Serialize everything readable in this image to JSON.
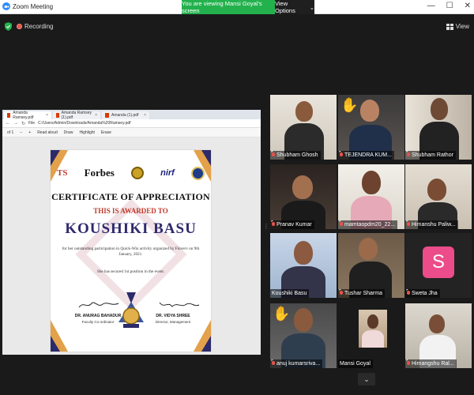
{
  "window": {
    "title": "Zoom Meeting",
    "banner": "You are viewing Mansi Goyal's screen",
    "view_options": "View Options",
    "view_options_chevron": "⌄",
    "controls": {
      "minimize": "—",
      "maximize": "☐",
      "close": "✕"
    }
  },
  "meeting": {
    "recording_label": "Recording",
    "view_label": "View"
  },
  "browser": {
    "tabs": [
      {
        "label": "Amanda Ramsey.pdf",
        "close": "×"
      },
      {
        "label": "Amanda Ramsey (1).pdf",
        "close": "×"
      },
      {
        "label": "Amanda (1).pdf",
        "close": "×"
      }
    ],
    "nav": {
      "back": "←",
      "forward": "→",
      "refresh": "↻"
    },
    "file_label": "File",
    "url": "C:/Users/Admin/Downloads/Amanda%20Ramsey.pdf",
    "toolbar": {
      "page": "of 1",
      "zoom_out": "−",
      "zoom_in": "+",
      "read_aloud": "Read aloud",
      "draw": "Draw",
      "highlight": "Highlight",
      "erase": "Erase"
    }
  },
  "certificate": {
    "logos": {
      "ts": "TS",
      "forbes": "Forbes",
      "nirf": "nirf"
    },
    "title": "CERTIFICATE OF APPRECIATION",
    "awarded": "THIS IS AWARDED TO",
    "name": "KOUSHIKI BASU",
    "body": "for her outstanding participation in Quick-Win activity organized by Finverv on 9th January, 2021.",
    "line2": "She has secured 1st position in the event.",
    "signer_left": "DR. ANURAG BAHADUR",
    "role_left": "Faculty Co-ordinator",
    "signer_right": "DR. VIDYA SHREE",
    "role_right": "Director, Management"
  },
  "participants": [
    {
      "name": "Shubham Ghosh"
    },
    {
      "name": "TEJENDRA KUM..."
    },
    {
      "name": "Shubham Rathor"
    },
    {
      "name": "Pranav Kumar"
    },
    {
      "name": "mamtaopdm20_22..."
    },
    {
      "name": "Himanshu Paliw..."
    },
    {
      "name": "Koushiki Basu"
    },
    {
      "name": "Tushar Sharma"
    },
    {
      "name": "Sweta Jha",
      "avatar_letter": "S"
    },
    {
      "name": "anuj kumarsriva..."
    },
    {
      "name": "Mansi Goyal"
    },
    {
      "name": "Himangshu Ral..."
    }
  ],
  "bottom": {
    "chevron": "⌄"
  },
  "colors": {
    "banner_green": "#23b14d",
    "speaker_outline": "#e6e24c",
    "avatar_pink": "#ec4c8a",
    "muted_red": "#e5534b"
  }
}
